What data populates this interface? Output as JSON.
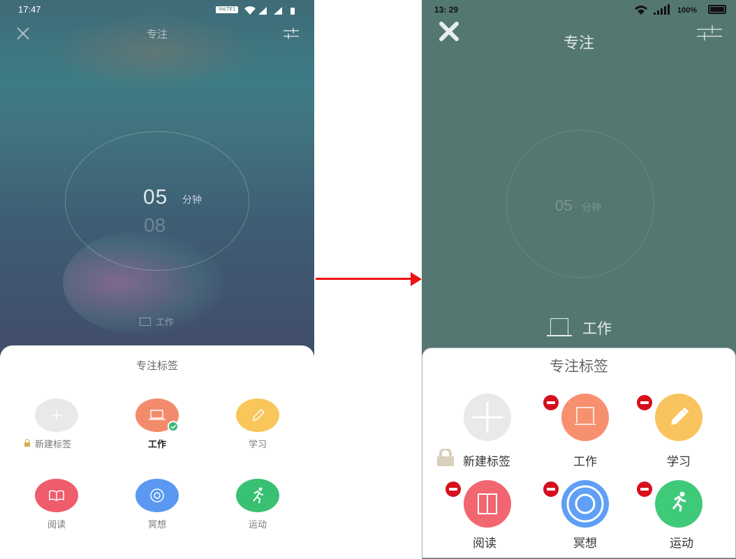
{
  "left": {
    "status": {
      "time": "17:47",
      "network_badge": "VoLTE1"
    },
    "title": "专注",
    "timer": {
      "minutes": "05",
      "unit": "分钟",
      "next_minutes": "08"
    },
    "current_tag": "工作",
    "sheet": {
      "title": "专注标签",
      "tags": [
        {
          "label": "新建标签",
          "icon": "plus-icon",
          "color": "#e9e9e9",
          "locked": true
        },
        {
          "label": "工作",
          "icon": "laptop-icon",
          "color": "#f28b6c",
          "selected": true
        },
        {
          "label": "学习",
          "icon": "pencil-icon",
          "color": "#f8c65a"
        },
        {
          "label": "阅读",
          "icon": "book-icon",
          "color": "#ef5c6b"
        },
        {
          "label": "冥想",
          "icon": "meditation-icon",
          "color": "#5a98f2"
        },
        {
          "label": "运动",
          "icon": "run-icon",
          "color": "#38c172"
        }
      ]
    }
  },
  "right": {
    "status": {
      "time": "13: 29",
      "battery": "100%"
    },
    "title": "专注",
    "timer": {
      "minutes": "05",
      "unit": "分钟"
    },
    "current_tag": "工作",
    "sheet": {
      "title": "专注标签",
      "tags": [
        {
          "label": "新建标签",
          "icon": "plus-icon",
          "color": "#e9e9e9",
          "locked": true
        },
        {
          "label": "工作",
          "icon": "square-icon",
          "color": "#f7906f"
        },
        {
          "label": "学习",
          "icon": "pencil-icon",
          "color": "#f9c35d"
        },
        {
          "label": "阅读",
          "icon": "book-icon",
          "color": "#f16670"
        },
        {
          "label": "冥想",
          "icon": "meditation-icon",
          "color": "#5f9ff5"
        },
        {
          "label": "运动",
          "icon": "run-icon",
          "color": "#3fca7a"
        }
      ]
    }
  },
  "colors": {
    "arrow": "#ee1111",
    "delete_badge": "#d60f1d"
  }
}
